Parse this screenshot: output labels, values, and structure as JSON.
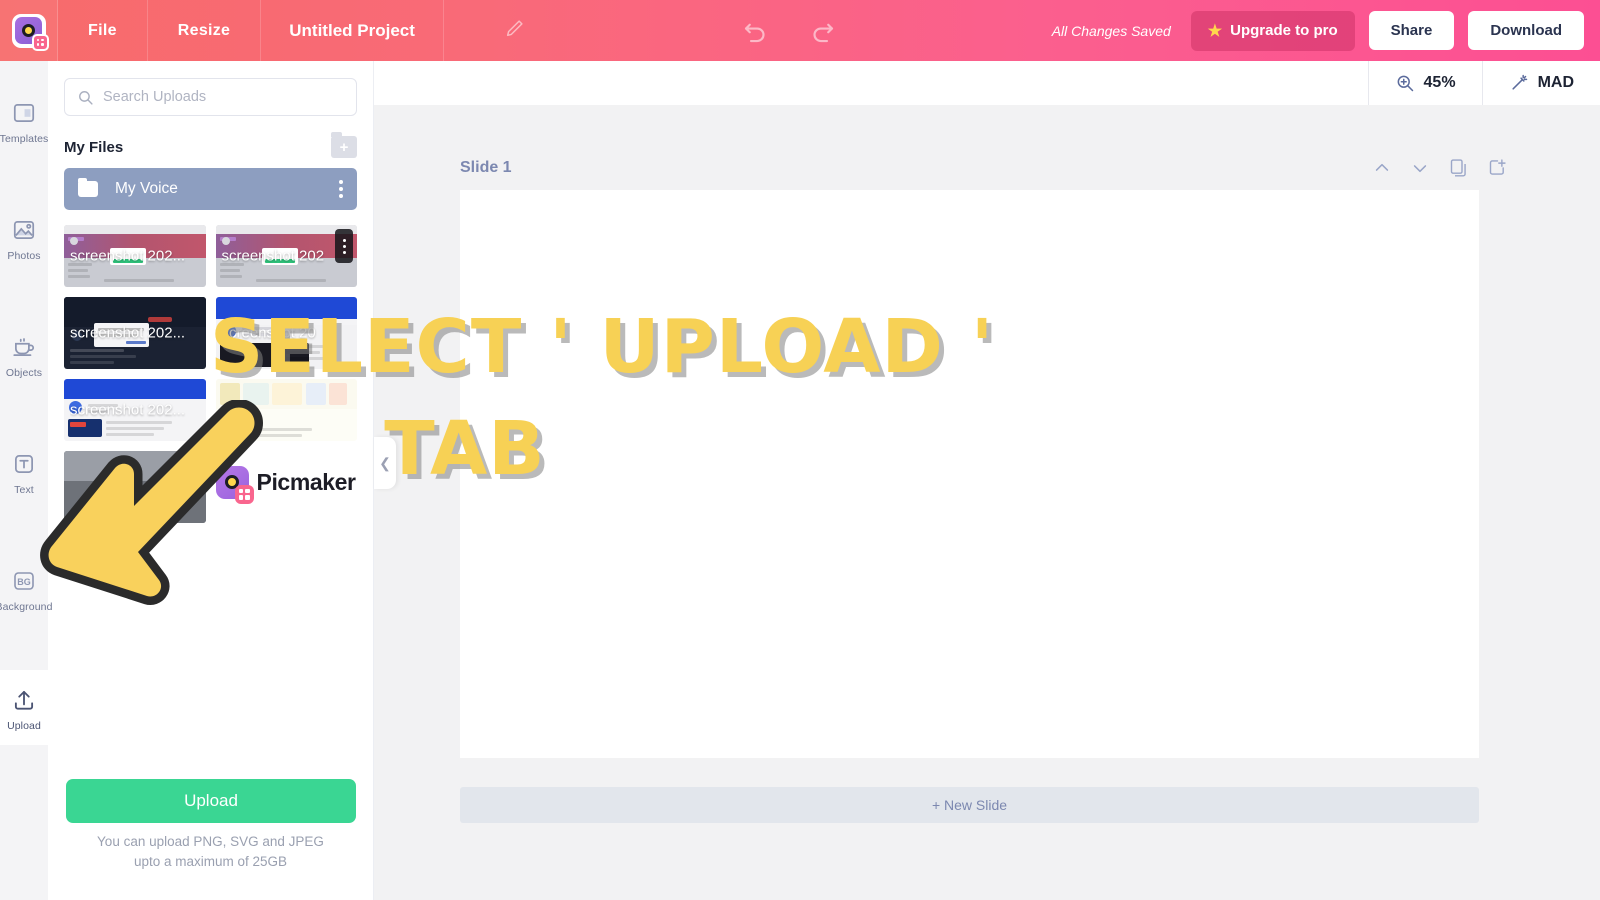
{
  "header": {
    "logo_name": "picmaker-logo",
    "menu": [
      {
        "label": "File",
        "name": "menu-file"
      },
      {
        "label": "Resize",
        "name": "menu-resize"
      }
    ],
    "project_title": "Untitled Project",
    "edit_icon": "pencil-icon",
    "undo_icon": "undo-icon",
    "redo_icon": "redo-icon",
    "saved_status": "All Changes Saved",
    "upgrade_label": "Upgrade to pro",
    "upgrade_icon": "star-icon",
    "share_label": "Share",
    "download_label": "Download",
    "gradient_from": "#f76b6b",
    "gradient_to": "#fc4f93"
  },
  "subheader": {
    "zoom_level": "45%",
    "zoom_icon": "zoom-in-icon",
    "mad_label": "MAD",
    "mad_icon": "magic-wand-icon"
  },
  "rail": {
    "items": [
      {
        "label": "Templates",
        "name": "sidebar-item-templates",
        "icon": "templates-icon",
        "active": false
      },
      {
        "label": "Photos",
        "name": "sidebar-item-photos",
        "icon": "photo-icon",
        "active": false
      },
      {
        "label": "Objects",
        "name": "sidebar-item-objects",
        "icon": "cup-icon",
        "active": false
      },
      {
        "label": "Text",
        "name": "sidebar-item-text",
        "icon": "text-icon",
        "active": false
      },
      {
        "label": "Background",
        "name": "sidebar-item-background",
        "icon": "bg-icon",
        "active": false
      },
      {
        "label": "Upload",
        "name": "sidebar-item-upload",
        "icon": "upload-icon",
        "active": true
      }
    ]
  },
  "panel": {
    "search_placeholder": "Search Uploads",
    "search_value": "",
    "search_icon": "search-icon",
    "files_title": "My Files",
    "new_folder_icon": "new-folder-icon",
    "folder": {
      "name": "My Voice",
      "icon": "folder-icon",
      "menu_icon": "kebab-menu-icon",
      "selected": true,
      "bg": "#8d9ec0"
    },
    "thumbnails": [
      {
        "title": "screenshot 202...",
        "name": "upload-thumb-1",
        "kind": "light-dashboard",
        "menu": false
      },
      {
        "title": "screenshot 202",
        "name": "upload-thumb-2",
        "kind": "light-dashboard",
        "menu": true
      },
      {
        "title": "screenshot 202...",
        "name": "upload-thumb-3",
        "kind": "dark-dialog",
        "menu": false
      },
      {
        "title": "screenshot 20",
        "name": "upload-thumb-4",
        "kind": "blue-video",
        "menu": false
      },
      {
        "title": "screenshot 202...",
        "name": "upload-thumb-5",
        "kind": "blue-article",
        "menu": false
      },
      {
        "title": "",
        "name": "upload-thumb-6",
        "kind": "infographic",
        "menu": false
      },
      {
        "title": "",
        "name": "upload-thumb-7",
        "kind": "grey-plain",
        "menu": false
      }
    ],
    "brand_item": {
      "word": "Picmaker",
      "name": "upload-thumb-logo"
    },
    "upload_button": "Upload",
    "upload_button_color": "#3ad693",
    "hint_line1": "You can upload PNG, SVG and JPEG",
    "hint_line2": "upto a maximum of 25GB",
    "collapse_icon": "chevron-left-icon"
  },
  "canvas": {
    "slide_label": "Slide 1",
    "tools": [
      {
        "name": "move-slide-up-button",
        "icon": "chevron-up-icon"
      },
      {
        "name": "move-slide-down-button",
        "icon": "chevron-down-icon"
      },
      {
        "name": "duplicate-slide-button",
        "icon": "duplicate-icon"
      },
      {
        "name": "add-slide-button",
        "icon": "add-slide-icon"
      }
    ],
    "new_slide_label": "+ New Slide",
    "slide_bg": "#ffffff"
  },
  "annotation": {
    "line1": "SELECT ' UPLOAD '",
    "line2": "TAB",
    "text_color": "#f7d155",
    "arrow_fill": "#f9d15c",
    "arrow_stroke": "#2b2b2b",
    "arrow_name": "instruction-arrow"
  }
}
